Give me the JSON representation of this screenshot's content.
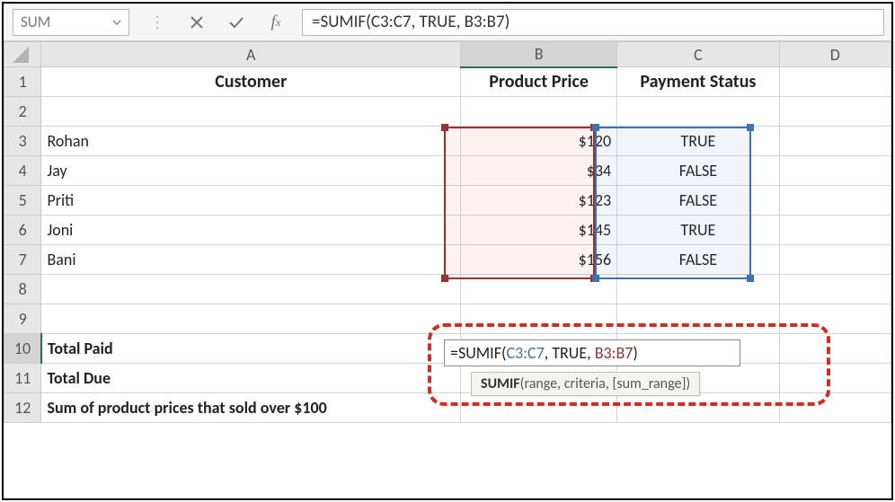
{
  "namebox": {
    "value": "SUM"
  },
  "formulaBar": {
    "value": "=SUMIF(C3:C7, TRUE, B3:B7)"
  },
  "columns": {
    "A": "A",
    "B": "B",
    "C": "C",
    "D": "D"
  },
  "header": {
    "A": "Customer",
    "B": "Product Price",
    "C": "Payment Status"
  },
  "rows": [
    {
      "n": "3",
      "customer": "Rohan",
      "price": "$120",
      "status": "TRUE"
    },
    {
      "n": "4",
      "customer": "Jay",
      "price": "$34",
      "status": "FALSE"
    },
    {
      "n": "5",
      "customer": "Priti",
      "price": "$123",
      "status": "FALSE"
    },
    {
      "n": "6",
      "customer": "Joni",
      "price": "$145",
      "status": "TRUE"
    },
    {
      "n": "7",
      "customer": "Bani",
      "price": "$156",
      "status": "FALSE"
    }
  ],
  "summary": {
    "totalPaidLabel": "Total Paid",
    "totalDueLabel": "Total Due",
    "sumOverLabel": "Sum of product prices that sold over $100"
  },
  "editCell": {
    "prefix": "=SUMIF(",
    "arg1": "C3:C7",
    "sep1": ", TRUE, ",
    "arg2": "B3:B7",
    "suffix": ")"
  },
  "tooltip": {
    "fname": "SUMIF",
    "sig": "(range, criteria, [sum_range])"
  },
  "rowNums": {
    "r1": "1",
    "r2": "2",
    "r3": "3",
    "r4": "4",
    "r5": "5",
    "r6": "6",
    "r7": "7",
    "r8": "8",
    "r9": "9",
    "r10": "10",
    "r11": "11",
    "r12": "12"
  }
}
